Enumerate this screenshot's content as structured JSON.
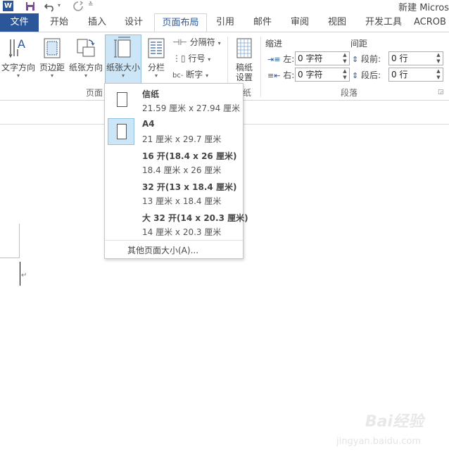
{
  "window": {
    "title": "新建 Micros"
  },
  "quick_access": {
    "icons": [
      "word-icon",
      "save-icon",
      "undo-icon",
      "redo-icon",
      "customize-icon"
    ]
  },
  "tabs": {
    "file": "文件",
    "home": "开始",
    "insert": "插入",
    "design": "设计",
    "layout": "页面布局",
    "references": "引用",
    "mailings": "邮件",
    "review": "审阅",
    "view": "视图",
    "developer": "开发工具",
    "acrobat": "ACROB"
  },
  "ribbon": {
    "page_setup": {
      "text_direction": "文字方向",
      "margins": "页边距",
      "orientation": "纸张方向",
      "size": "纸张大小",
      "columns": "分栏",
      "breaks": "分隔符",
      "line_numbers": "行号",
      "hyphenation": "断字",
      "group_label": "页面"
    },
    "manuscript": {
      "label1": "稿纸",
      "label2": "设置",
      "group_label": "纸"
    },
    "paragraph": {
      "indent_title": "缩进",
      "spacing_title": "间距",
      "indent_left_label": "左:",
      "indent_right_label": "右:",
      "indent_left_value": "0 字符",
      "indent_right_value": "0 字符",
      "spacing_before_label": "段前:",
      "spacing_after_label": "段后:",
      "spacing_before_value": "0 行",
      "spacing_after_value": "0 行",
      "group_label": "段落"
    }
  },
  "size_menu": {
    "items": [
      {
        "name": "信纸",
        "dims": "21.59 厘米 x 27.94 厘米"
      },
      {
        "name": "A4",
        "dims": "21 厘米 x 29.7 厘米",
        "selected": true
      },
      {
        "name": "16 开(18.4 x 26 厘米)",
        "dims": "18.4 厘米 x 26 厘米"
      },
      {
        "name": "32 开(13 x 18.4 厘米)",
        "dims": "13 厘米 x 18.4 厘米"
      },
      {
        "name": "大 32 开(14 x 20.3 厘米)",
        "dims": "14 厘米 x 20.3 厘米"
      }
    ],
    "more": "其他页面大小(A)..."
  },
  "document": {
    "paragraph_mark": "↵"
  },
  "watermark": {
    "text": "Bai经验",
    "url": "jingyan.baidu.com"
  }
}
